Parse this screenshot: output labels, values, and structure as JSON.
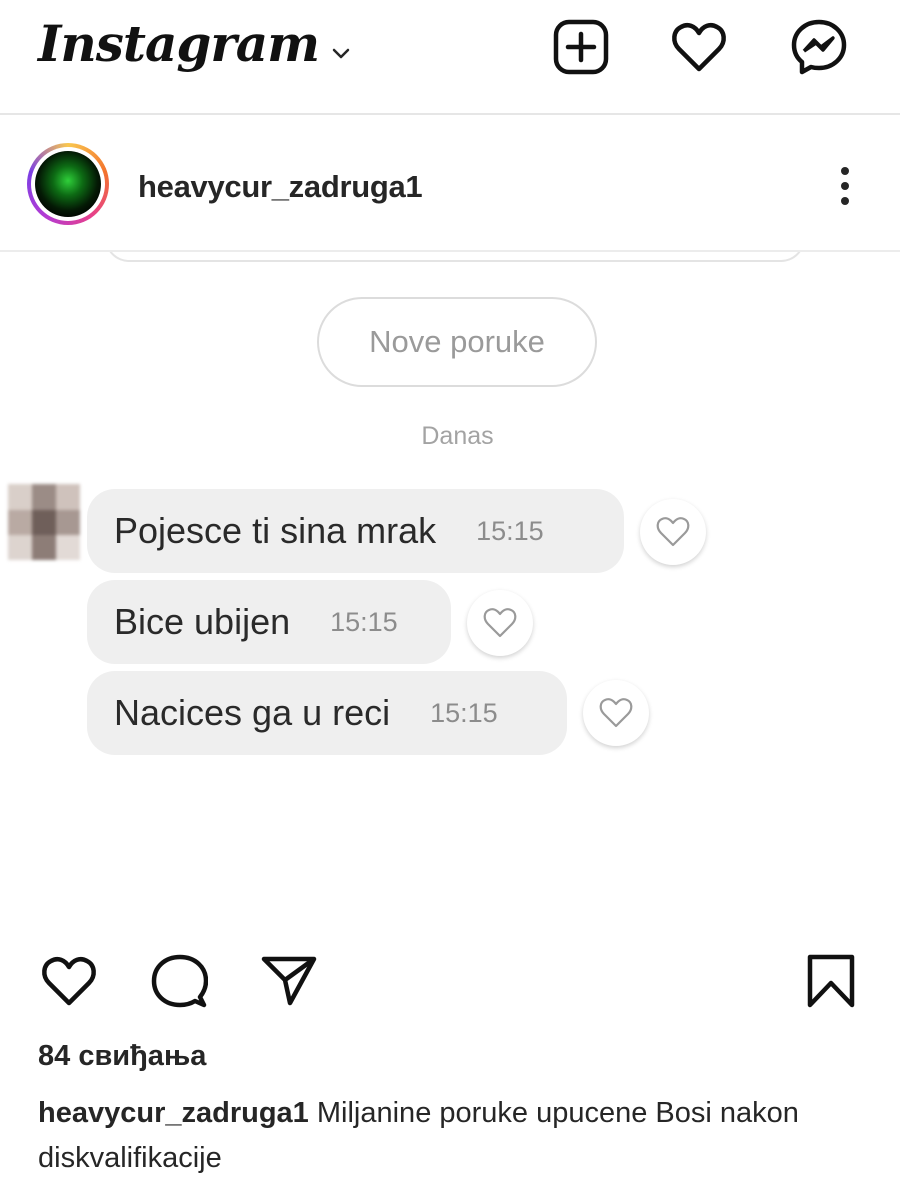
{
  "app": {
    "logo_text": "Instagram"
  },
  "post": {
    "username": "heavycur_zadruga1",
    "likes_text": "84 свиђања",
    "caption_username": "heavycur_zadruga1",
    "caption_text": "Miljanine poruke upucene Bosi nakon diskvalifikacije"
  },
  "screenshot": {
    "new_messages_label": "Nove poruke",
    "date_label": "Danas",
    "messages": [
      {
        "text": "Pojesce ti sina mrak",
        "time": "15:15"
      },
      {
        "text": "Bice ubijen",
        "time": "15:15"
      },
      {
        "text": "Nacices ga u reci",
        "time": "15:15"
      }
    ]
  },
  "icons": {
    "top_bar": [
      "chevron-down-icon",
      "new-post-icon",
      "activity-heart-icon",
      "messenger-icon"
    ],
    "post_actions": [
      "like-heart-icon",
      "comment-icon",
      "share-icon",
      "save-bookmark-icon"
    ],
    "post_header": [
      "more-options-icon"
    ]
  },
  "colors": {
    "text": "#262626",
    "bubble": "#efefef",
    "muted": "#9a9a9a",
    "divider": "#e6e6e6"
  }
}
